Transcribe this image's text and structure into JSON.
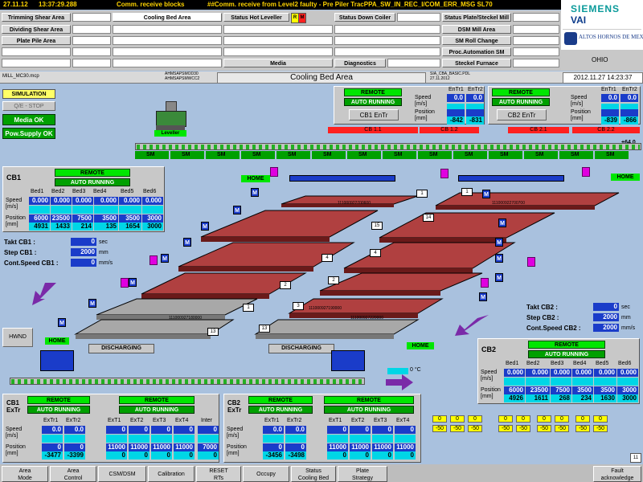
{
  "topbar": {
    "date": "27.11.12",
    "time": "13:37:29.288",
    "msg1": "Comm. receive blocks",
    "msg2": "##Comm. receive from Level2 faulty - Pre Piler TracPPA_SW_IN_REC_I/COM_ERR_MSG SL70"
  },
  "menu": {
    "col1": [
      "Trimming Shear Area",
      "Dividing Shear Area",
      "Plate Pile Area"
    ],
    "col2": [
      "Cooling Bed Area"
    ],
    "col3": [
      "Status Hot Leveller",
      "Media"
    ],
    "col4": [
      "Status Down Coiler",
      "Diagnostics"
    ],
    "col5": [
      "Status Plate/Steckel Mill",
      "DSM Mill Area",
      "SM Roll Change",
      "Proc.Automation SM",
      "Steckel Furnace"
    ],
    "badge_r": "R",
    "badge_m": "M"
  },
  "logo": {
    "brand": "SIEMENS",
    "brand2": "VAI",
    "company": "ALTOS HORNOS DE MEXICO",
    "site": "OHIO"
  },
  "titlebar": {
    "left": "MILL_MC30.mcp",
    "mid1": "AHMSAPSMOD30",
    "mid2": "AHMSAPSMWCC2",
    "title": "Cooling Bed Area",
    "right1": "SIA_CBA_BASIC.PDL",
    "right2": "27.11.2012",
    "datetime": "2012.11.27  14:23:37"
  },
  "left_status": {
    "simulation": "SIMULATION",
    "qe_stop": "Q/E - STOP",
    "media_ok": "Media OK",
    "pow_supply_ok": "Pow.Supply OK",
    "leveller": "Leveller",
    "hwnd": "HWND"
  },
  "entry_panel": {
    "remote": "REMOTE",
    "auto": "AUTO RUNNING",
    "speed": "Speed",
    "speed_unit": "[m/s]",
    "position": "Position",
    "position_unit": "[mm]",
    "entr1": "EnTr1",
    "entr2": "EnTr2",
    "cb1": {
      "label": "CB1 EnTr",
      "speed": [
        "0.0",
        "0.0"
      ],
      "pos": [
        "-842",
        "-831"
      ]
    },
    "cb2": {
      "label": "CB2 EnTr",
      "speed": [
        "0.0",
        "0.0"
      ],
      "pos": [
        "-839",
        "-866"
      ]
    }
  },
  "red_labels": [
    "CB 1.1",
    "CB 1.2",
    "CB 2.1",
    "CB 2.2"
  ],
  "rail_value": "+64.0",
  "sm_label": "SM",
  "cb1": {
    "title": "CB1",
    "remote": "REMOTE",
    "auto": "AUTO RUNNING",
    "beds": [
      "Bed1",
      "Bed2",
      "Bed3",
      "Bed4",
      "Bed5",
      "Bed6"
    ],
    "speed_label": "Speed",
    "speed_unit": "[m/s]",
    "position_label": "Position",
    "position_unit": "[mm]",
    "speed": [
      "0.000",
      "0.000",
      "0.000",
      "0.000",
      "0.000",
      "0.000"
    ],
    "pos_set": [
      "6000",
      "23500",
      "7500",
      "3500",
      "3500",
      "3000"
    ],
    "pos_act": [
      "4931",
      "1433",
      "214",
      "135",
      "1654",
      "3000"
    ],
    "takt_label": "Takt CB1 :",
    "takt": "0",
    "takt_unit": "sec",
    "step_label": "Step CB1 :",
    "step": "2000",
    "step_unit": "mm",
    "cont_label": "Cont.Speed CB1 :",
    "cont": "0",
    "cont_unit": "mm/s"
  },
  "cb2": {
    "title": "CB2",
    "remote": "REMOTE",
    "auto": "AUTO RUNNING",
    "beds": [
      "Bed1",
      "Bed2",
      "Bed3",
      "Bed4",
      "Bed5",
      "Bed6"
    ],
    "speed_label": "Speed",
    "speed_unit": "[m/s]",
    "position_label": "Position",
    "position_unit": "[mm]",
    "speed": [
      "0.000",
      "0.000",
      "0.000",
      "0.000",
      "0.000",
      "0.000"
    ],
    "pos_set": [
      "6000",
      "23500",
      "7500",
      "3500",
      "3500",
      "3000"
    ],
    "pos_act": [
      "4926",
      "1611",
      "268",
      "234",
      "1630",
      "3000"
    ],
    "takt_label": "Takt CB2 :",
    "takt": "0",
    "takt_unit": "sec",
    "step_label": "Step CB2 :",
    "step": "2000",
    "step_unit": "mm",
    "cont_label": "Cont.Speed CB2 :",
    "cont": "2000",
    "cont_unit": "mm/s"
  },
  "beds_upper": [
    "15",
    "14",
    "13",
    "4",
    "2",
    "1",
    "3"
  ],
  "bed_ids": [
    "111000922700700",
    "111000922700600",
    "111000927180000",
    "111000927190000",
    "111000927220000"
  ],
  "home": "HOME",
  "discharging": "DISCHARGING",
  "temp": {
    "value": "0",
    "unit": "°C"
  },
  "cb1_extr": {
    "title": "CB1",
    "sub": "ExTr",
    "remote": "REMOTE",
    "auto": "AUTO RUNNING",
    "cols": [
      "ExTr1",
      "ExTr2",
      "ExT1",
      "ExT2",
      "ExT3",
      "ExT4",
      "Inter"
    ],
    "speed": [
      "0.0",
      "0.0",
      "0",
      "0",
      "0",
      "0",
      "0"
    ],
    "pos_set": [
      "0",
      "0",
      "11000",
      "11000",
      "11000",
      "11000",
      "7000"
    ],
    "pos_act": [
      "-3477",
      "-3399",
      "0",
      "0",
      "0",
      "0",
      "0"
    ],
    "speed_label": "Speed",
    "speed_unit": "[m/s]",
    "position_label": "Position",
    "position_unit": "[mm]"
  },
  "cb2_extr": {
    "title": "CB2",
    "sub": "ExTr",
    "remote": "REMOTE",
    "auto": "AUTO RUNNING",
    "cols": [
      "ExTr1",
      "ExTr2",
      "ExT1",
      "ExT2",
      "ExT3",
      "ExT4"
    ],
    "speed": [
      "0.0",
      "0.0",
      "0",
      "0",
      "0",
      "0"
    ],
    "pos_set": [
      "0",
      "0",
      "11000",
      "11000",
      "11000",
      "11000"
    ],
    "pos_act": [
      "-3456",
      "-3498",
      "0",
      "0",
      "0",
      "0"
    ],
    "speed_label": "Speed",
    "speed_unit": "[m/s]",
    "position_label": "Position",
    "position_unit": "[mm]"
  },
  "yellow_row1": [
    "0",
    "0",
    "0",
    "0",
    "0",
    "0",
    "0",
    "0",
    "0"
  ],
  "yellow_row2": [
    "-50",
    "-50",
    "-50",
    "-50",
    "-50",
    "-50",
    "-50",
    "-50",
    "-50"
  ],
  "corner_num": "11",
  "bottom_buttons": [
    [
      "Area",
      "Mode"
    ],
    [
      "Area",
      "Control"
    ],
    [
      "CSM/DSM",
      ""
    ],
    [
      "Calibration",
      ""
    ],
    [
      "RESET",
      "RTs"
    ],
    [
      "Occupy",
      ""
    ],
    [
      "Status",
      "Cooling Bed"
    ],
    [
      "Plate",
      "Strategy"
    ],
    [
      "Fault",
      "acknowledge"
    ]
  ]
}
